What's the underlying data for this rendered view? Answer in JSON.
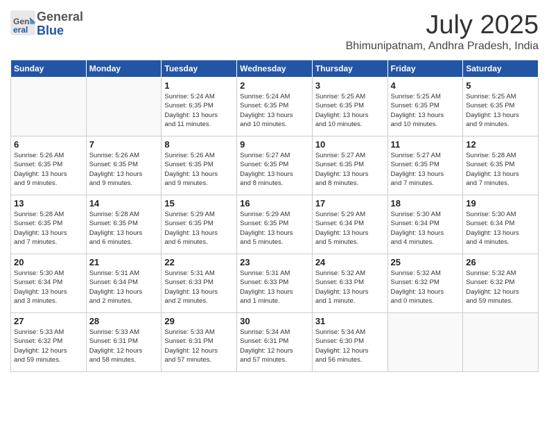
{
  "header": {
    "logo": {
      "general": "General",
      "blue": "Blue"
    },
    "title": "July 2025",
    "location": "Bhimunipatnam, Andhra Pradesh, India"
  },
  "weekdays": [
    "Sunday",
    "Monday",
    "Tuesday",
    "Wednesday",
    "Thursday",
    "Friday",
    "Saturday"
  ],
  "weeks": [
    [
      {
        "day": "",
        "info": ""
      },
      {
        "day": "",
        "info": ""
      },
      {
        "day": "1",
        "info": "Sunrise: 5:24 AM\nSunset: 6:35 PM\nDaylight: 13 hours\nand 11 minutes."
      },
      {
        "day": "2",
        "info": "Sunrise: 5:24 AM\nSunset: 6:35 PM\nDaylight: 13 hours\nand 10 minutes."
      },
      {
        "day": "3",
        "info": "Sunrise: 5:25 AM\nSunset: 6:35 PM\nDaylight: 13 hours\nand 10 minutes."
      },
      {
        "day": "4",
        "info": "Sunrise: 5:25 AM\nSunset: 6:35 PM\nDaylight: 13 hours\nand 10 minutes."
      },
      {
        "day": "5",
        "info": "Sunrise: 5:25 AM\nSunset: 6:35 PM\nDaylight: 13 hours\nand 9 minutes."
      }
    ],
    [
      {
        "day": "6",
        "info": "Sunrise: 5:26 AM\nSunset: 6:35 PM\nDaylight: 13 hours\nand 9 minutes."
      },
      {
        "day": "7",
        "info": "Sunrise: 5:26 AM\nSunset: 6:35 PM\nDaylight: 13 hours\nand 9 minutes."
      },
      {
        "day": "8",
        "info": "Sunrise: 5:26 AM\nSunset: 6:35 PM\nDaylight: 13 hours\nand 9 minutes."
      },
      {
        "day": "9",
        "info": "Sunrise: 5:27 AM\nSunset: 6:35 PM\nDaylight: 13 hours\nand 8 minutes."
      },
      {
        "day": "10",
        "info": "Sunrise: 5:27 AM\nSunset: 6:35 PM\nDaylight: 13 hours\nand 8 minutes."
      },
      {
        "day": "11",
        "info": "Sunrise: 5:27 AM\nSunset: 6:35 PM\nDaylight: 13 hours\nand 7 minutes."
      },
      {
        "day": "12",
        "info": "Sunrise: 5:28 AM\nSunset: 6:35 PM\nDaylight: 13 hours\nand 7 minutes."
      }
    ],
    [
      {
        "day": "13",
        "info": "Sunrise: 5:28 AM\nSunset: 6:35 PM\nDaylight: 13 hours\nand 7 minutes."
      },
      {
        "day": "14",
        "info": "Sunrise: 5:28 AM\nSunset: 6:35 PM\nDaylight: 13 hours\nand 6 minutes."
      },
      {
        "day": "15",
        "info": "Sunrise: 5:29 AM\nSunset: 6:35 PM\nDaylight: 13 hours\nand 6 minutes."
      },
      {
        "day": "16",
        "info": "Sunrise: 5:29 AM\nSunset: 6:35 PM\nDaylight: 13 hours\nand 5 minutes."
      },
      {
        "day": "17",
        "info": "Sunrise: 5:29 AM\nSunset: 6:34 PM\nDaylight: 13 hours\nand 5 minutes."
      },
      {
        "day": "18",
        "info": "Sunrise: 5:30 AM\nSunset: 6:34 PM\nDaylight: 13 hours\nand 4 minutes."
      },
      {
        "day": "19",
        "info": "Sunrise: 5:30 AM\nSunset: 6:34 PM\nDaylight: 13 hours\nand 4 minutes."
      }
    ],
    [
      {
        "day": "20",
        "info": "Sunrise: 5:30 AM\nSunset: 6:34 PM\nDaylight: 13 hours\nand 3 minutes."
      },
      {
        "day": "21",
        "info": "Sunrise: 5:31 AM\nSunset: 6:34 PM\nDaylight: 13 hours\nand 2 minutes."
      },
      {
        "day": "22",
        "info": "Sunrise: 5:31 AM\nSunset: 6:33 PM\nDaylight: 13 hours\nand 2 minutes."
      },
      {
        "day": "23",
        "info": "Sunrise: 5:31 AM\nSunset: 6:33 PM\nDaylight: 13 hours\nand 1 minute."
      },
      {
        "day": "24",
        "info": "Sunrise: 5:32 AM\nSunset: 6:33 PM\nDaylight: 13 hours\nand 1 minute."
      },
      {
        "day": "25",
        "info": "Sunrise: 5:32 AM\nSunset: 6:32 PM\nDaylight: 13 hours\nand 0 minutes."
      },
      {
        "day": "26",
        "info": "Sunrise: 5:32 AM\nSunset: 6:32 PM\nDaylight: 12 hours\nand 59 minutes."
      }
    ],
    [
      {
        "day": "27",
        "info": "Sunrise: 5:33 AM\nSunset: 6:32 PM\nDaylight: 12 hours\nand 59 minutes."
      },
      {
        "day": "28",
        "info": "Sunrise: 5:33 AM\nSunset: 6:31 PM\nDaylight: 12 hours\nand 58 minutes."
      },
      {
        "day": "29",
        "info": "Sunrise: 5:33 AM\nSunset: 6:31 PM\nDaylight: 12 hours\nand 57 minutes."
      },
      {
        "day": "30",
        "info": "Sunrise: 5:34 AM\nSunset: 6:31 PM\nDaylight: 12 hours\nand 57 minutes."
      },
      {
        "day": "31",
        "info": "Sunrise: 5:34 AM\nSunset: 6:30 PM\nDaylight: 12 hours\nand 56 minutes."
      },
      {
        "day": "",
        "info": ""
      },
      {
        "day": "",
        "info": ""
      }
    ]
  ]
}
